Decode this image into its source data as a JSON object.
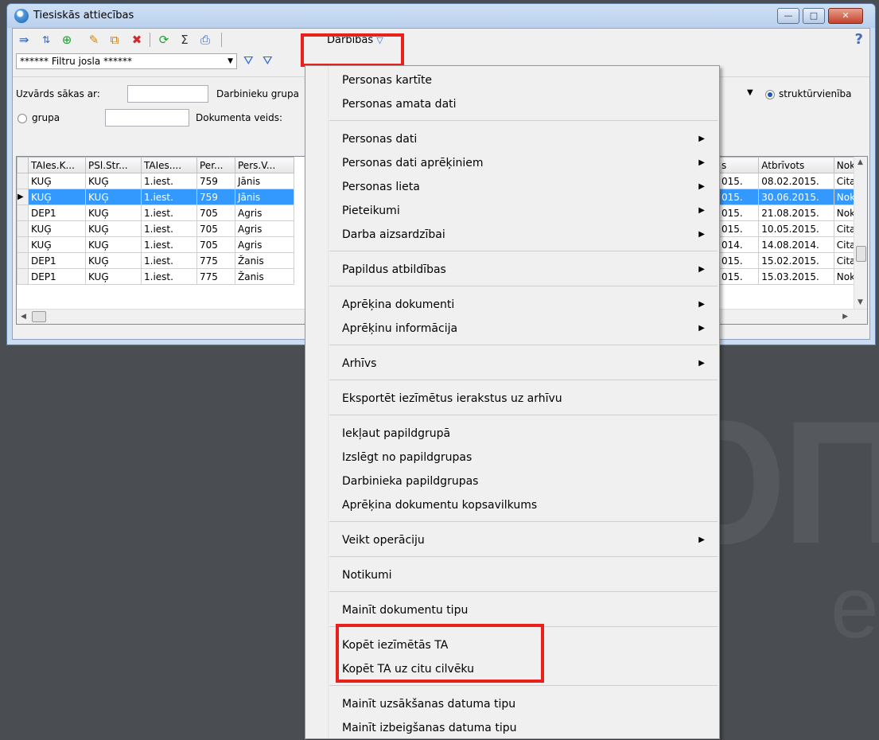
{
  "window": {
    "title": "Tiesiskās attiecības",
    "controls": {
      "minimize": "—",
      "maximize": "□",
      "close": "✕"
    }
  },
  "toolbar": {
    "actions_label": "Darbības",
    "actions_arrow": "▽",
    "help": "?",
    "icons": [
      "export-icon",
      "sort-icon",
      "add-icon",
      "edit-icon",
      "copy-icon",
      "delete-icon",
      "refresh-icon",
      "sum-icon",
      "print-icon"
    ]
  },
  "filter": {
    "selected": "****** Filtru josla ******",
    "arrow": "▼"
  },
  "search": {
    "surname_label": "Uzvārds sākas ar:",
    "group_label_left": "Darbinieku grupa",
    "radio_group": "grupa",
    "doc_type_label": "Dokumenta veids:",
    "radio_unit": "struktūrvienība",
    "combo_arrow": "▼"
  },
  "grid": {
    "headers": [
      "TAIes.K...",
      "PSl.Str...",
      "TAIes....",
      "Per...",
      "Pers.V..."
    ],
    "rows": [
      [
        "KUĢ",
        "KUĢ",
        "1.iest.",
        "759",
        "Jānis"
      ],
      [
        "KUĢ",
        "KUĢ",
        "1.iest.",
        "759",
        "Jānis"
      ],
      [
        "DEP1",
        "KUĢ",
        "1.iest.",
        "705",
        "Agris"
      ],
      [
        "KUĢ",
        "KUĢ",
        "1.iest.",
        "705",
        "Agris"
      ],
      [
        "KUĢ",
        "KUĢ",
        "1.iest.",
        "705",
        "Agris"
      ],
      [
        "DEP1",
        "KUĢ",
        "1.iest.",
        "775",
        "Žanis"
      ],
      [
        "DEP1",
        "KUĢ",
        "1.iest.",
        "775",
        "Žanis"
      ]
    ],
    "right_headers": [
      "s",
      "Atbrīvots",
      "Noklu"
    ],
    "right_rows": [
      [
        "015.",
        "08.02.2015.",
        "Citas"
      ],
      [
        "015.",
        "30.06.2015.",
        "Noklu"
      ],
      [
        "015.",
        "21.08.2015.",
        "Noklu"
      ],
      [
        "015.",
        "10.05.2015.",
        "Citas"
      ],
      [
        "014.",
        "14.08.2014.",
        "Citas"
      ],
      [
        "015.",
        "15.02.2015.",
        "Citas"
      ],
      [
        "015.",
        "15.03.2015.",
        "Noklu"
      ]
    ],
    "selected_row": 1,
    "row_indicator": "▶"
  },
  "menu": {
    "submenu_arrow": "▶",
    "items": [
      {
        "label": "Personas kartīte",
        "sub": false
      },
      {
        "label": "Personas amata dati",
        "sub": false
      },
      {
        "label": "Personas dati",
        "sub": true
      },
      {
        "label": "Personas dati aprēķiniem",
        "sub": true
      },
      {
        "label": "Personas lieta",
        "sub": true
      },
      {
        "label": "Pieteikumi",
        "sub": true
      },
      {
        "label": "Darba aizsardzībai",
        "sub": true
      },
      {
        "label": "Papildus atbildības",
        "sub": true
      },
      {
        "label": "Aprēķina dokumenti",
        "sub": true
      },
      {
        "label": "Aprēķinu informācija",
        "sub": true
      },
      {
        "label": "Arhīvs",
        "sub": true
      },
      {
        "label": "Eksportēt iezīmētus ierakstus uz arhīvu",
        "sub": false
      },
      {
        "label": "Iekļaut papildgrupā",
        "sub": false
      },
      {
        "label": "Izslēgt no papildgrupas",
        "sub": false
      },
      {
        "label": "Darbinieka papildgrupas",
        "sub": false
      },
      {
        "label": "Aprēķina dokumentu kopsavilkums",
        "sub": false
      },
      {
        "label": "Veikt operāciju",
        "sub": true
      },
      {
        "label": "Notikumi",
        "sub": false
      },
      {
        "label": "Mainīt dokumentu tipu",
        "sub": false
      },
      {
        "label": "Kopēt iezīmētās TA",
        "sub": false
      },
      {
        "label": "Kopēt TA uz citu cilvēku",
        "sub": false
      },
      {
        "label": "Mainīt uzsākšanas datuma tipu",
        "sub": false
      },
      {
        "label": "Mainīt izbeigšanas datuma tipu",
        "sub": false
      }
    ]
  },
  "colors": {
    "highlight_box": "#e8211d",
    "selection": "#3399ff",
    "desktop": "#4a4d52"
  }
}
